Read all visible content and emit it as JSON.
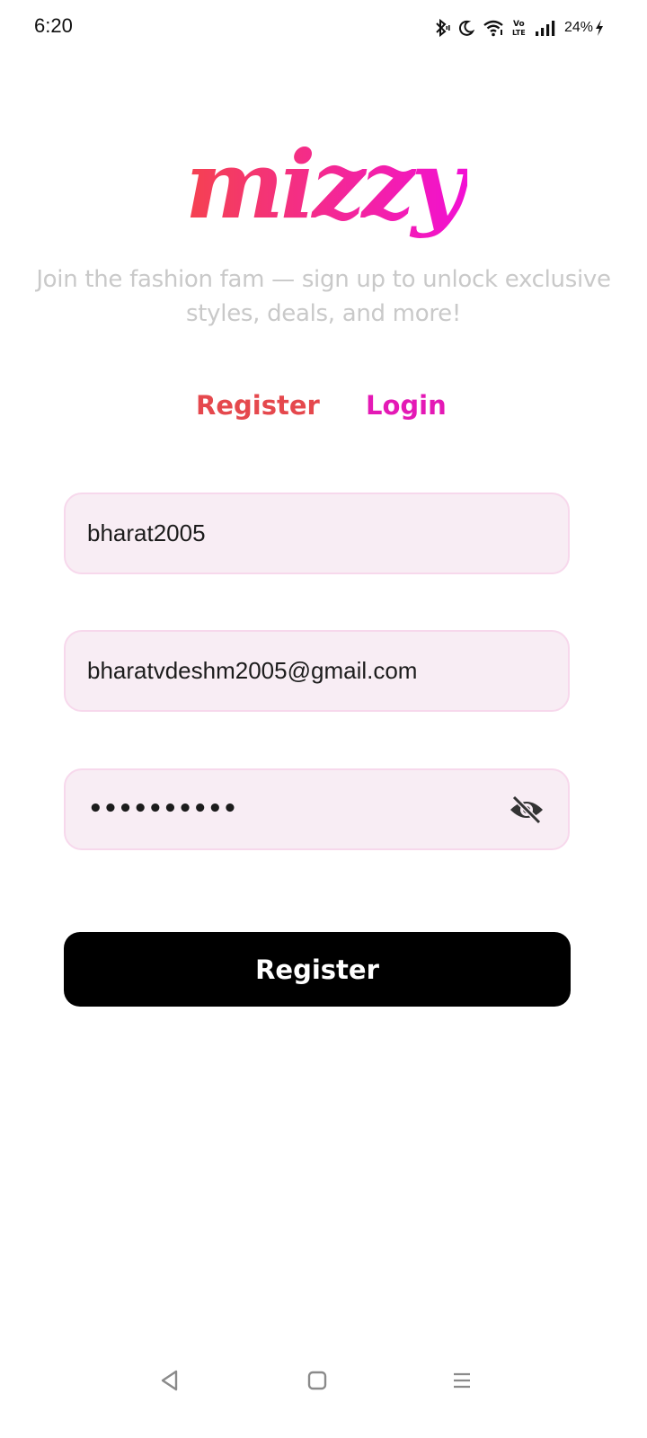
{
  "status_bar": {
    "time": "6:20",
    "battery": "24%",
    "icons": [
      "bluetooth-icon",
      "do-not-disturb-moon-icon",
      "wifi-icon",
      "volte-icon",
      "signal-icon",
      "charging-bolt-icon"
    ],
    "volte_label": "Vo\nLTE"
  },
  "logo": {
    "text": "mizzy",
    "gradient_start": "#f5424f",
    "gradient_end": "#f20fd6"
  },
  "tagline": "Join the fashion fam — sign up to unlock exclusive styles, deals, and more!",
  "tabs": {
    "register": "Register",
    "login": "Login",
    "register_color": "#e5484d",
    "login_color": "#e419b5"
  },
  "form": {
    "username_value": "bharat2005",
    "email_value": "bharatvdeshm2005@gmail.com",
    "password_masked": "••••••••••",
    "field_bg": "#f8edf4",
    "field_border": "#f7d8ec",
    "visibility_icon": "eye-off-icon"
  },
  "submit": {
    "label": "Register",
    "bg": "#000000"
  },
  "nav_bar": {
    "icons": [
      "back-triangle-icon",
      "home-square-icon",
      "recents-menu-icon"
    ]
  }
}
